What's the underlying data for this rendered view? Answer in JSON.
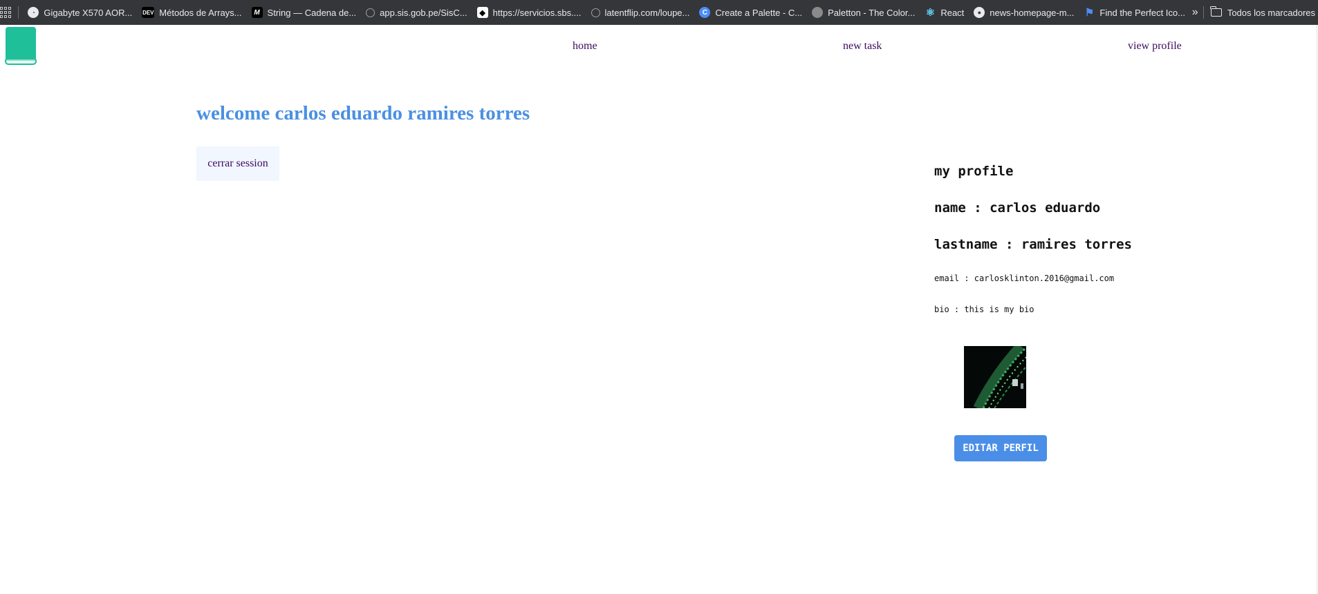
{
  "bookmarks": {
    "items": [
      {
        "label": "Gigabyte X570 AOR...",
        "icon": "gauge-icon",
        "color": "#e8eaed"
      },
      {
        "label": "Métodos de Arrays...",
        "icon": "dev-logo-icon",
        "color": "#000000"
      },
      {
        "label": "String — Cadena de...",
        "icon": "mdn-logo-icon",
        "color": "#000000"
      },
      {
        "label": "app.sis.gob.pe/SisC...",
        "icon": "globe-icon",
        "color": "#9aa0a6"
      },
      {
        "label": "https://servicios.sbs....",
        "icon": "sbs-logo-icon",
        "color": "#ffffff"
      },
      {
        "label": "latentflip.com/loupe...",
        "icon": "globe-icon",
        "color": "#9aa0a6"
      },
      {
        "label": "Create a Palette - C...",
        "icon": "coolors-logo-icon",
        "color": "#4c8ef7"
      },
      {
        "label": "Paletton - The Color...",
        "icon": "paletton-logo-icon",
        "color": "#8a8a8a"
      },
      {
        "label": "React",
        "icon": "react-logo-icon",
        "color": "#61dafb"
      },
      {
        "label": "news-homepage-m...",
        "icon": "github-logo-icon",
        "color": "#e8eaed"
      },
      {
        "label": "Find the Perfect Ico...",
        "icon": "flag-icon",
        "color": "#4c8ef7"
      }
    ],
    "more_icon": "chevron-double-right-icon",
    "folder_label": "Todos los marcadores"
  },
  "nav": {
    "home": "home",
    "new_task": "new task",
    "view_profile": "view profile"
  },
  "main": {
    "welcome": "welcome carlos eduardo ramires torres",
    "logout": "cerrar session"
  },
  "profile": {
    "title": "my profile",
    "name": "name : carlos eduardo",
    "lastname": "lastname : ramires torres",
    "email": "email : carlosklinton.2016@gmail.com",
    "bio": "bio : this is my bio",
    "edit": "EDITAR PERFIL"
  },
  "colors": {
    "accent": "#4a90e2",
    "link": "#3d0a5c",
    "logo": "#1fbf9a",
    "button": "#4a8ee8"
  }
}
